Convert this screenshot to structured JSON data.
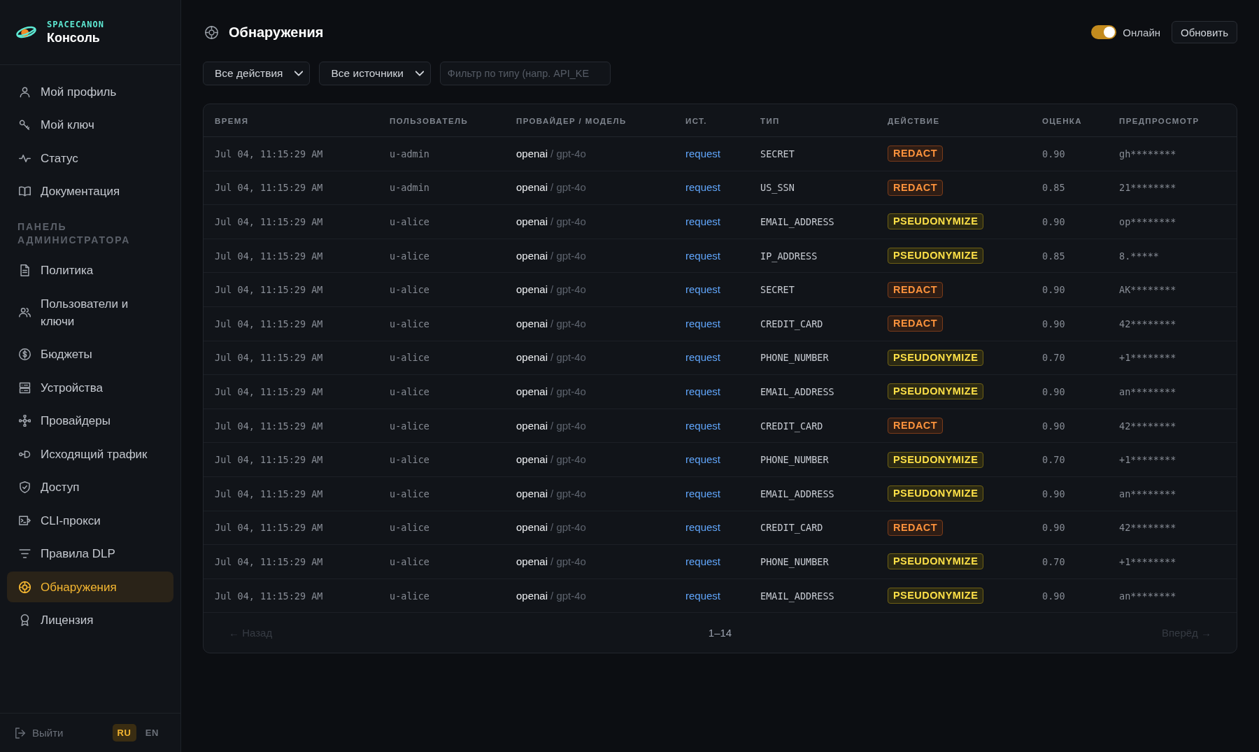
{
  "brand": {
    "overline": "SPACECANON",
    "title": "Консоль"
  },
  "sidebar": {
    "groups": [
      {
        "items": [
          {
            "label": "Мой профиль",
            "selected": false
          },
          {
            "label": "Мой ключ",
            "selected": false
          },
          {
            "label": "Статус",
            "selected": false
          },
          {
            "label": "Документация",
            "selected": false
          }
        ]
      },
      {
        "heading": "ПАНЕЛЬ АДМИНИСТРАТОРА",
        "items": [
          {
            "label": "Политика",
            "selected": false
          },
          {
            "label": "Пользователи и ключи",
            "selected": false
          },
          {
            "label": "Бюджеты",
            "selected": false
          },
          {
            "label": "Устройства",
            "selected": false
          },
          {
            "label": "Провайдеры",
            "selected": false
          },
          {
            "label": "Исходящий трафик",
            "selected": false
          },
          {
            "label": "Доступ",
            "selected": false
          },
          {
            "label": "CLI-прокси",
            "selected": false
          },
          {
            "label": "Правила DLP",
            "selected": false
          },
          {
            "label": "Обнаружения",
            "selected": true
          },
          {
            "label": "Лицензия",
            "selected": false
          }
        ]
      }
    ],
    "logout": "Выйти",
    "languages": [
      {
        "label": "RU",
        "selected": true
      },
      {
        "label": "EN",
        "selected": false
      }
    ]
  },
  "header": {
    "title": "Обнаружения",
    "status": {
      "label": "Онлайн",
      "on": true
    },
    "refresh_button": "Обновить"
  },
  "filters": {
    "action_select": "Все действия",
    "source_select": "Все источники",
    "type_filter": {
      "placeholder": "Фильтр по типу (напр. API_KE"
    }
  },
  "table": {
    "columns": [
      "ВРЕМЯ",
      "ПОЛЬЗОВАТЕЛЬ",
      "ПРОВАЙДЕР / МОДЕЛЬ",
      "ИСТ.",
      "ТИП",
      "ДЕЙСТВИЕ",
      "ОЦЕНКА",
      "ПРЕДПРОСМОТР"
    ],
    "rows": [
      {
        "time": "Jul 04, 11:15:29 AM",
        "user": "u-admin",
        "provider": "openai",
        "model": "/ gpt-4o",
        "source": "request",
        "type": "SECRET",
        "action": {
          "label": "REDACT",
          "kind": "redact"
        },
        "score": "0.90",
        "preview": "gh********"
      },
      {
        "time": "Jul 04, 11:15:29 AM",
        "user": "u-admin",
        "provider": "openai",
        "model": "/ gpt-4o",
        "source": "request",
        "type": "US_SSN",
        "action": {
          "label": "REDACT",
          "kind": "redact"
        },
        "score": "0.85",
        "preview": "21********"
      },
      {
        "time": "Jul 04, 11:15:29 AM",
        "user": "u-alice",
        "provider": "openai",
        "model": "/ gpt-4o",
        "source": "request",
        "type": "EMAIL_ADDRESS",
        "action": {
          "label": "PSEUDONYMIZE",
          "kind": "pseudonymize"
        },
        "score": "0.90",
        "preview": "op********"
      },
      {
        "time": "Jul 04, 11:15:29 AM",
        "user": "u-alice",
        "provider": "openai",
        "model": "/ gpt-4o",
        "source": "request",
        "type": "IP_ADDRESS",
        "action": {
          "label": "PSEUDONYMIZE",
          "kind": "pseudonymize"
        },
        "score": "0.85",
        "preview": "8.*****"
      },
      {
        "time": "Jul 04, 11:15:29 AM",
        "user": "u-alice",
        "provider": "openai",
        "model": "/ gpt-4o",
        "source": "request",
        "type": "SECRET",
        "action": {
          "label": "REDACT",
          "kind": "redact"
        },
        "score": "0.90",
        "preview": "AK********"
      },
      {
        "time": "Jul 04, 11:15:29 AM",
        "user": "u-alice",
        "provider": "openai",
        "model": "/ gpt-4o",
        "source": "request",
        "type": "CREDIT_CARD",
        "action": {
          "label": "REDACT",
          "kind": "redact"
        },
        "score": "0.90",
        "preview": "42********"
      },
      {
        "time": "Jul 04, 11:15:29 AM",
        "user": "u-alice",
        "provider": "openai",
        "model": "/ gpt-4o",
        "source": "request",
        "type": "PHONE_NUMBER",
        "action": {
          "label": "PSEUDONYMIZE",
          "kind": "pseudonymize"
        },
        "score": "0.70",
        "preview": "+1********"
      },
      {
        "time": "Jul 04, 11:15:29 AM",
        "user": "u-alice",
        "provider": "openai",
        "model": "/ gpt-4o",
        "source": "request",
        "type": "EMAIL_ADDRESS",
        "action": {
          "label": "PSEUDONYMIZE",
          "kind": "pseudonymize"
        },
        "score": "0.90",
        "preview": "an********"
      },
      {
        "time": "Jul 04, 11:15:29 AM",
        "user": "u-alice",
        "provider": "openai",
        "model": "/ gpt-4o",
        "source": "request",
        "type": "CREDIT_CARD",
        "action": {
          "label": "REDACT",
          "kind": "redact"
        },
        "score": "0.90",
        "preview": "42********"
      },
      {
        "time": "Jul 04, 11:15:29 AM",
        "user": "u-alice",
        "provider": "openai",
        "model": "/ gpt-4o",
        "source": "request",
        "type": "PHONE_NUMBER",
        "action": {
          "label": "PSEUDONYMIZE",
          "kind": "pseudonymize"
        },
        "score": "0.70",
        "preview": "+1********"
      },
      {
        "time": "Jul 04, 11:15:29 AM",
        "user": "u-alice",
        "provider": "openai",
        "model": "/ gpt-4o",
        "source": "request",
        "type": "EMAIL_ADDRESS",
        "action": {
          "label": "PSEUDONYMIZE",
          "kind": "pseudonymize"
        },
        "score": "0.90",
        "preview": "an********"
      },
      {
        "time": "Jul 04, 11:15:29 AM",
        "user": "u-alice",
        "provider": "openai",
        "model": "/ gpt-4o",
        "source": "request",
        "type": "CREDIT_CARD",
        "action": {
          "label": "REDACT",
          "kind": "redact"
        },
        "score": "0.90",
        "preview": "42********"
      },
      {
        "time": "Jul 04, 11:15:29 AM",
        "user": "u-alice",
        "provider": "openai",
        "model": "/ gpt-4o",
        "source": "request",
        "type": "PHONE_NUMBER",
        "action": {
          "label": "PSEUDONYMIZE",
          "kind": "pseudonymize"
        },
        "score": "0.70",
        "preview": "+1********"
      },
      {
        "time": "Jul 04, 11:15:29 AM",
        "user": "u-alice",
        "provider": "openai",
        "model": "/ gpt-4o",
        "source": "request",
        "type": "EMAIL_ADDRESS",
        "action": {
          "label": "PSEUDONYMIZE",
          "kind": "pseudonymize"
        },
        "score": "0.90",
        "preview": "an********"
      }
    ]
  },
  "pagination": {
    "previous": {
      "label": "← Назад",
      "disabled": true
    },
    "range": "1–14",
    "next": {
      "label": "Вперёд →",
      "disabled": true
    }
  }
}
